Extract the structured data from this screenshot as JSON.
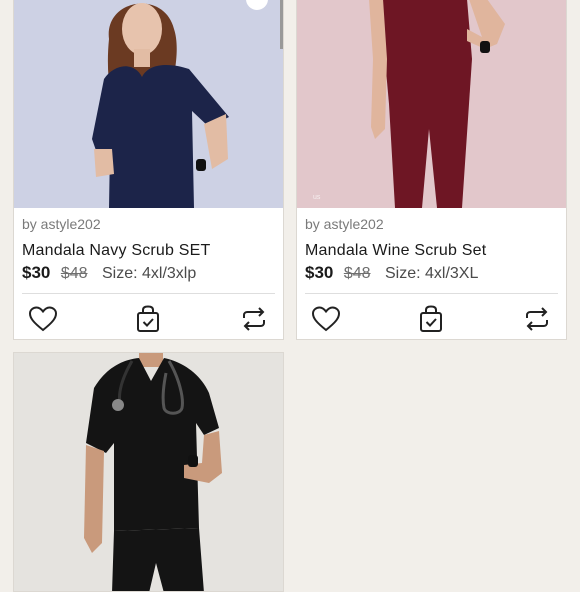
{
  "listings": [
    {
      "seller": "by astyle202",
      "title": "Mandala Navy Scrub SET",
      "price": "$30",
      "original_price": "$48",
      "size": "Size: 4xl/3xlp",
      "image_bg": "#cdd1e4",
      "garment_color": "#1c2449"
    },
    {
      "seller": "by astyle202",
      "title": "Mandala Wine Scrub Set",
      "price": "$30",
      "original_price": "$48",
      "size": "Size: 4xl/3XL",
      "image_bg": "#e2c7cb",
      "garment_color": "#6e1624"
    },
    {
      "image_bg": "#e5e3df",
      "garment_color": "#141414"
    }
  ],
  "icons": {
    "like": "heart-icon",
    "bag": "shopping-bag-icon",
    "share": "repost-icon"
  },
  "colors": {
    "page_bg": "#f2efea",
    "text": "#1b1b1b",
    "muted": "#7a7a7a"
  }
}
